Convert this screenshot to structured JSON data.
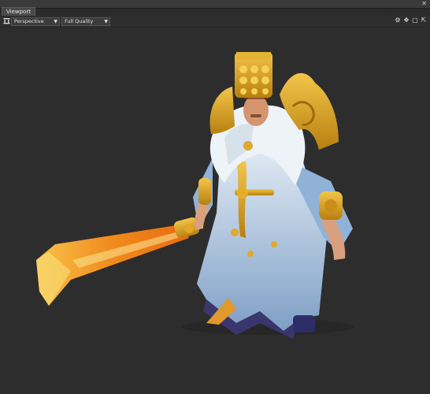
{
  "window": {
    "tab_label": "Viewport",
    "close_glyph": "✕"
  },
  "toolbar": {
    "camera_icon": "camera-icon",
    "view_mode": "Perspective",
    "quality": "Full Quality",
    "right_icons": [
      "gear-icon",
      "move-icon",
      "frame-icon",
      "popout-icon"
    ]
  },
  "scene": {
    "description_name": "hero-3d-model",
    "colors": {
      "background": "#2d2d2d",
      "gold": "#d9a21f",
      "robe": "#8fb2d6",
      "fur": "#eef3f7",
      "sword": "#f18a1e"
    }
  }
}
